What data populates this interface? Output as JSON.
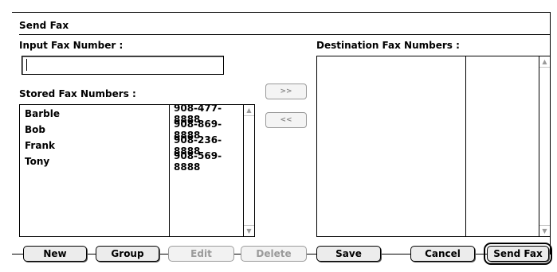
{
  "window": {
    "title": "Send Fax"
  },
  "input_fax": {
    "label": "Input Fax Number :",
    "value": ""
  },
  "stored": {
    "label": "Stored Fax Numbers :",
    "items": [
      {
        "name": "Barble",
        "number": "908-477-8888"
      },
      {
        "name": "Bob",
        "number": "908-869-8888"
      },
      {
        "name": "Frank",
        "number": "908-236-8888"
      },
      {
        "name": "Tony",
        "number": "908-569-8888"
      }
    ]
  },
  "destination": {
    "label": "Destination Fax Numbers :"
  },
  "transfer": {
    "add_label": ">>",
    "remove_label": "<<"
  },
  "buttons": {
    "new": "New",
    "group": "Group",
    "edit": "Edit",
    "delete": "Delete",
    "save": "Save",
    "cancel": "Cancel",
    "send": "Send Fax"
  },
  "icons": {
    "scroll_up": "scroll-up-arrow-icon",
    "scroll_down": "scroll-down-arrow-icon"
  }
}
